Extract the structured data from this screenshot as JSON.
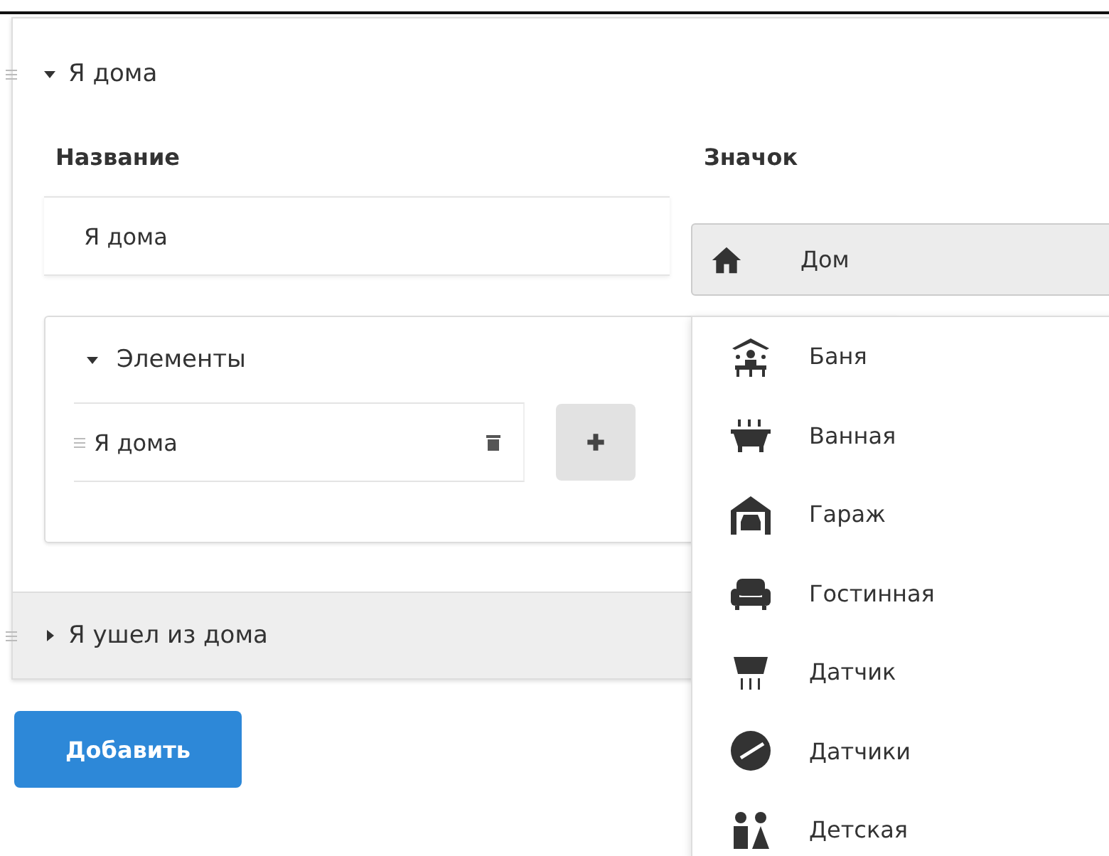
{
  "sections": [
    {
      "title": "Я дома",
      "expanded": true
    },
    {
      "title": "Я ушел из дома",
      "expanded": false
    }
  ],
  "name_label": "Название",
  "name_value": "Я дома",
  "icon_label": "Значок",
  "icon_value": "Дом",
  "elements": {
    "title": "Элементы",
    "expanded": true,
    "items": [
      "Я дома"
    ]
  },
  "icon_options": [
    "Баня",
    "Ванная",
    "Гараж",
    "Гостинная",
    "Датчик",
    "Датчики",
    "Детская"
  ],
  "add_button": "Добавить"
}
